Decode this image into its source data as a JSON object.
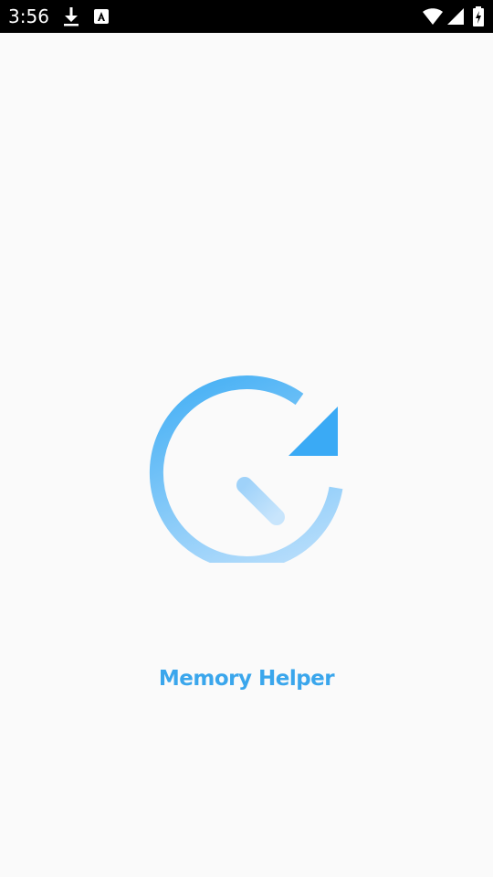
{
  "status_bar": {
    "time": "3:56",
    "icons": [
      "download-icon",
      "a11y-icon",
      "wifi-icon",
      "signal-icon",
      "battery-icon"
    ],
    "background": "#000000"
  },
  "splash": {
    "background": "#fafafa",
    "logo_icon": "history-clock-icon",
    "logo_colors": [
      "#2fa6f3",
      "#a6d6fb"
    ],
    "app_name": "Memory Helper",
    "title_color": "#3aa6ec"
  }
}
